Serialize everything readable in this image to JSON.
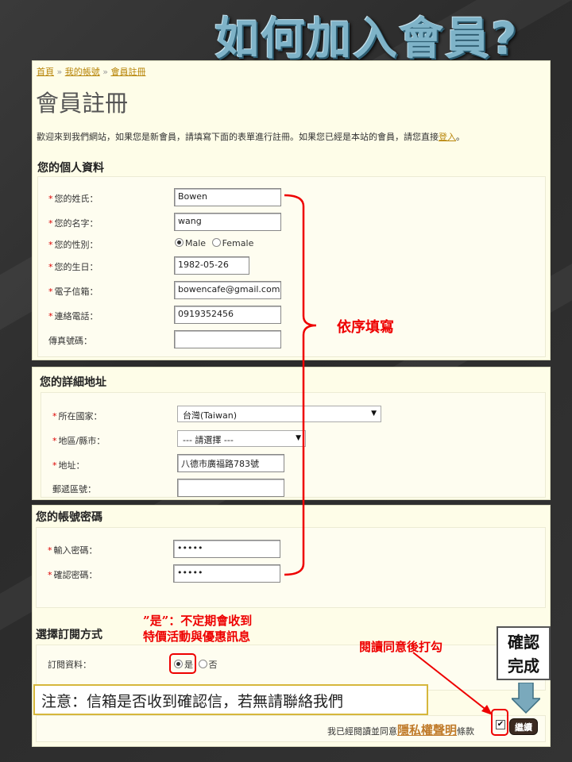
{
  "slide": {
    "title": "如何加入會員?"
  },
  "breadcrumb": {
    "home": "首頁",
    "account": "我的帳號",
    "register": "會員註冊",
    "sep": "»"
  },
  "page": {
    "heading": "會員註冊",
    "intro_prefix": "歡迎來到我們網站，如果您是新會員，請填寫下面的表單進行註冊。如果您已經是本站的會員，請您直接",
    "intro_login": "登入",
    "intro_suffix": "。"
  },
  "personal": {
    "title": "您的個人資料",
    "last_name_label": "您的姓氏：",
    "last_name_value": "Bowen",
    "first_name_label": "您的名字：",
    "first_name_value": "wang",
    "gender_label": "您的性別：",
    "gender_male": "Male",
    "gender_female": "Female",
    "birthday_label": "您的生日：",
    "birthday_value": "1982-05-26",
    "email_label": "電子信箱：",
    "email_value": "bowencafe@gmail.com",
    "phone_label": "連絡電話：",
    "phone_value": "0919352456",
    "fax_label": "傳真號碼：",
    "fax_value": ""
  },
  "address": {
    "title": "您的詳細地址",
    "country_label": "所在國家：",
    "country_value": "台灣(Taiwan)",
    "region_label": "地區/縣市：",
    "region_value": "--- 請選擇 ---",
    "street_label": "地址：",
    "street_value": "八德市廣福路783號",
    "zip_label": "郵遞區號：",
    "zip_value": ""
  },
  "password": {
    "title": "您的帳號密碼",
    "pw_label": "輸入密碼：",
    "pw_value": "•••••",
    "confirm_label": "確認密碼：",
    "confirm_value": "•••••"
  },
  "newsletter": {
    "title": "選擇訂閱方式",
    "label": "訂閱資料：",
    "yes": "是",
    "no": "否"
  },
  "footer": {
    "agree_prefix": "我已經閱讀並同意",
    "privacy": "隱私權聲明",
    "agree_suffix": "條款",
    "register_button": "繼續",
    "check_mark": "✔"
  },
  "annotations": {
    "fill_order": "依序填寫",
    "yes_note_1": "”是”：不定期會收到",
    "yes_note_2": "特價活動與優惠訊息",
    "read_check": "閱讀同意後打勾",
    "confirm_1": "確認",
    "confirm_2": "完成",
    "email_notice": "注意：信箱是否收到確認信，若無請聯絡我們"
  },
  "required_mark": "*",
  "icons": {
    "select_arrow": "▼"
  },
  "colors": {
    "accent_red": "#ee0000",
    "link": "#b8860b",
    "panel_bg": "#fefde8",
    "title_blue": "#7fb3c8"
  }
}
